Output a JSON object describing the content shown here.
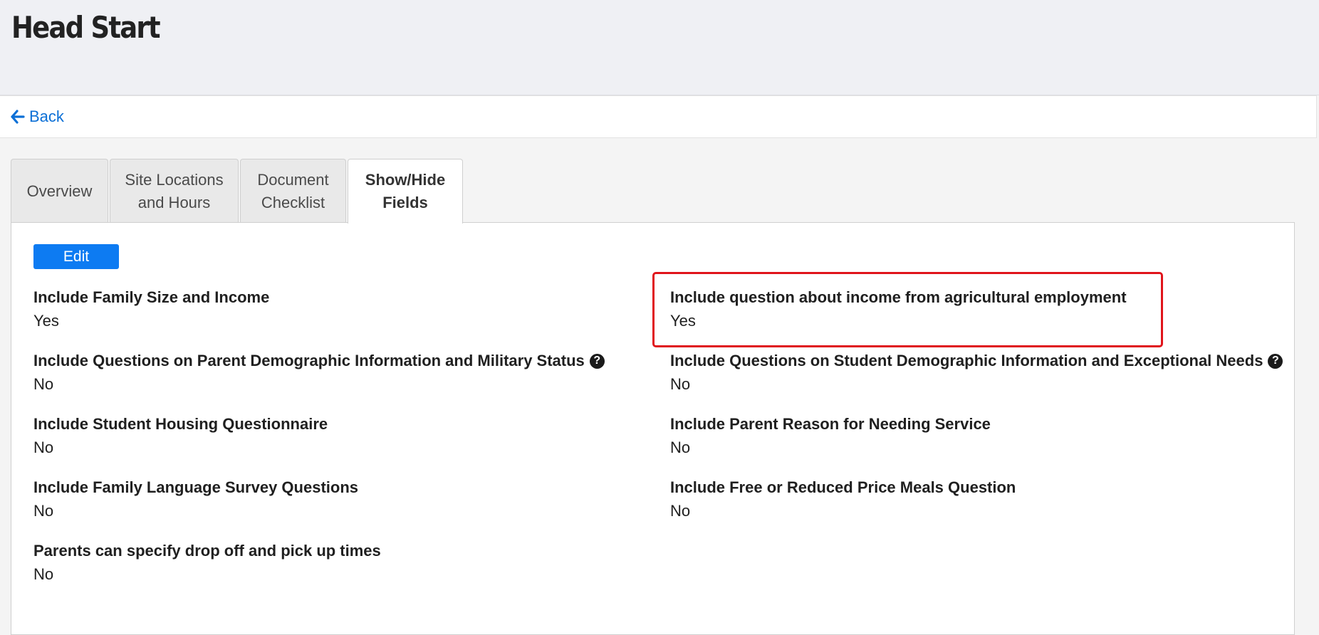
{
  "header": {
    "title": "Head Start"
  },
  "nav": {
    "back_label": "Back"
  },
  "tabs": [
    {
      "label": "Overview",
      "active": false
    },
    {
      "label": "Site Locations\nand Hours",
      "active": false
    },
    {
      "label": "Document\nChecklist",
      "active": false
    },
    {
      "label": "Show/Hide\nFields",
      "active": true
    }
  ],
  "actions": {
    "edit_label": "Edit"
  },
  "fields": {
    "family_size_income": {
      "label": "Include Family Size and Income",
      "value": "Yes"
    },
    "agricultural_income": {
      "label": "Include question about income from agricultural employment",
      "value": "Yes"
    },
    "parent_demographic": {
      "label": "Include Questions on Parent Demographic Information and Military Status",
      "value": "No"
    },
    "student_demographic": {
      "label": "Include Questions on Student Demographic Information and Exceptional Needs",
      "value": "No"
    },
    "student_housing": {
      "label": "Include Student Housing Questionnaire",
      "value": "No"
    },
    "parent_reason": {
      "label": "Include Parent Reason for Needing Service",
      "value": "No"
    },
    "family_language": {
      "label": "Include Family Language Survey Questions",
      "value": "No"
    },
    "free_reduced_meals": {
      "label": "Include Free or Reduced Price Meals Question",
      "value": "No"
    },
    "drop_off_pick_up": {
      "label": "Parents can specify drop off and pick up times",
      "value": "No"
    }
  },
  "colors": {
    "accent": "#0d7bf2",
    "link": "#0b6fd6",
    "highlight": "#e0141b"
  },
  "icons": [
    "arrow-left-icon",
    "help-icon"
  ]
}
